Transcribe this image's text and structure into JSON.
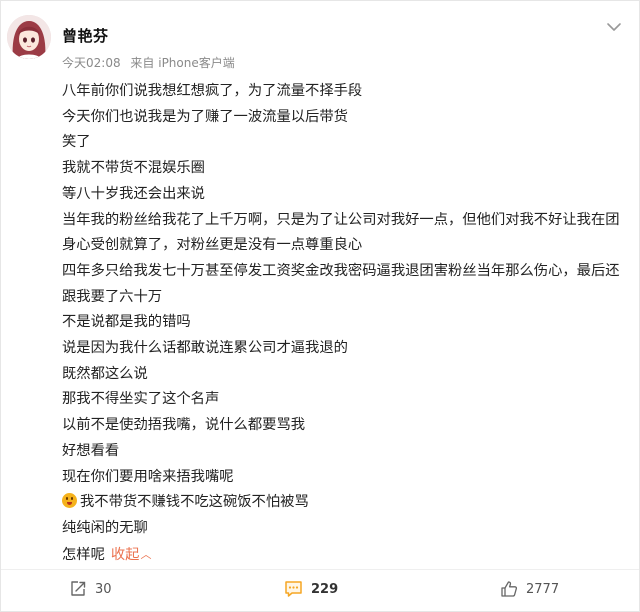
{
  "post": {
    "author": "曾艳芬",
    "time": "今天02:08",
    "source": "来自 iPhone客户端",
    "lines": [
      "八年前你们说我想红想疯了，为了流量不择手段",
      "今天你们也说我是为了赚了一波流量以后带货",
      "笑了",
      "我就不带货不混娱乐圈",
      "等八十岁我还会出来说",
      "当年我的粉丝给我花了上千万啊，只是为了让公司对我好一点，但他们对我不好让我在团身心受创就算了，对粉丝更是没有一点尊重良心",
      "四年多只给我发七十万甚至停发工资奖金改我密码逼我退团害粉丝当年那么伤心，最后还跟我要了六十万",
      "不是说都是我的错吗",
      "说是因为我什么话都敢说连累公司才逼我退的",
      "既然都这么说",
      "那我不得坐实了这个名声",
      "以前不是使劲捂我嘴，说什么都要骂我",
      "好想看看",
      "现在你们要用啥来捂我嘴呢",
      "我不带货不赚钱不吃这碗饭不怕被骂",
      "纯纯闲的无聊",
      "怎样呢"
    ],
    "collapse_label": "收起",
    "emoji_icon": "grinning-face-emoji"
  },
  "actions": {
    "share_count": "30",
    "comment_count": "229",
    "like_count": "2777"
  },
  "colors": {
    "accent": "#eb7350",
    "meta": "#8a8a8a",
    "comment_icon": "#f5a623"
  }
}
